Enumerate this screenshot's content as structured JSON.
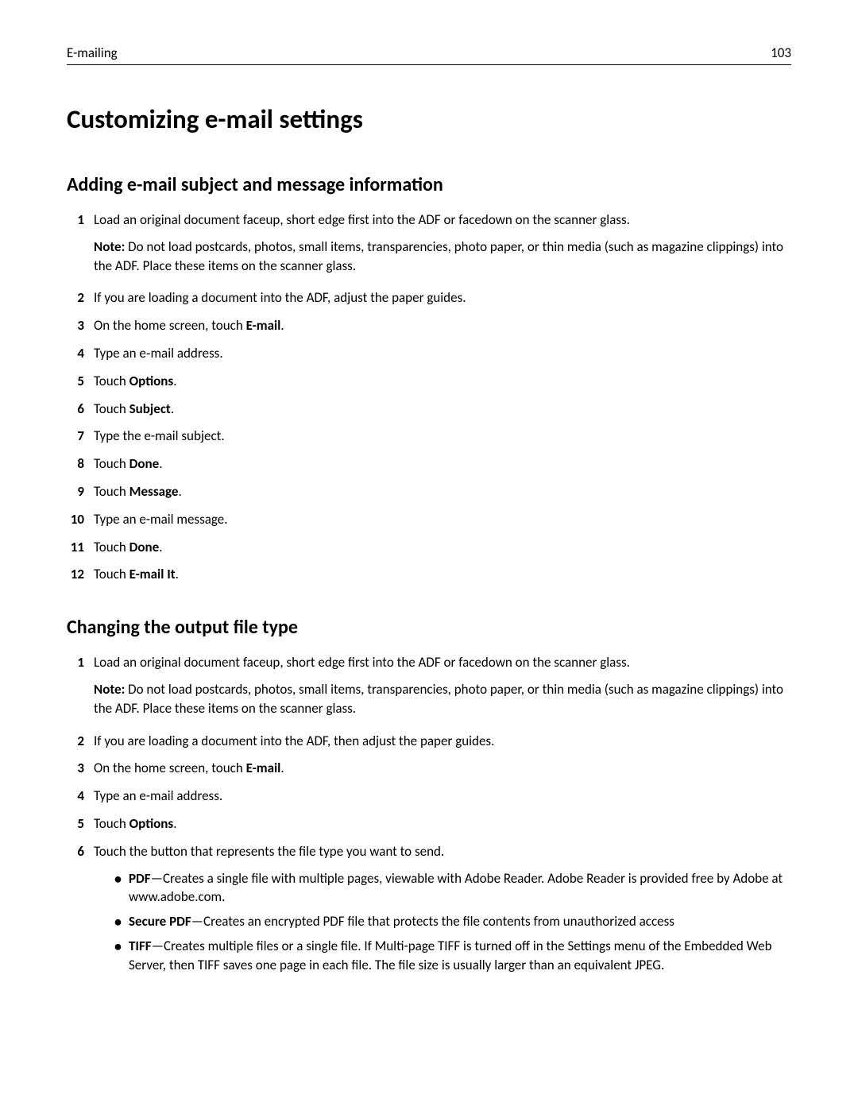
{
  "header": {
    "section_name": "E-mailing",
    "page_number": "103"
  },
  "main_heading": "Customizing e-mail settings",
  "section1": {
    "heading": "Adding e-mail subject and message information",
    "steps": [
      {
        "num": "1",
        "text": "Load an original document faceup, short edge first into the ADF or facedown on the scanner glass.",
        "note_label": "Note:",
        "note_text": " Do not load postcards, photos, small items, transparencies, photo paper, or thin media (such as magazine clippings) into the ADF. Place these items on the scanner glass."
      },
      {
        "num": "2",
        "text": "If you are loading a document into the ADF, adjust the paper guides."
      },
      {
        "num": "3",
        "prefix": "On the home screen, touch ",
        "bold": "E-mail",
        "suffix": "."
      },
      {
        "num": "4",
        "text": "Type an e‑mail address."
      },
      {
        "num": "5",
        "prefix": "Touch ",
        "bold": "Options",
        "suffix": "."
      },
      {
        "num": "6",
        "prefix": "Touch ",
        "bold": "Subject",
        "suffix": "."
      },
      {
        "num": "7",
        "text": "Type the e-mail subject."
      },
      {
        "num": "8",
        "prefix": "Touch ",
        "bold": "Done",
        "suffix": "."
      },
      {
        "num": "9",
        "prefix": "Touch ",
        "bold": "Message",
        "suffix": "."
      },
      {
        "num": "10",
        "text": "Type an e-mail message."
      },
      {
        "num": "11",
        "prefix": "Touch ",
        "bold": "Done",
        "suffix": "."
      },
      {
        "num": "12",
        "prefix": "Touch ",
        "bold": "E-mail It",
        "suffix": "."
      }
    ]
  },
  "section2": {
    "heading": "Changing the output file type",
    "steps": [
      {
        "num": "1",
        "text": "Load an original document faceup, short edge first into the ADF or facedown on the scanner glass.",
        "note_label": "Note:",
        "note_text": " Do not load postcards, photos, small items, transparencies, photo paper, or thin media (such as magazine clippings) into the ADF. Place these items on the scanner glass."
      },
      {
        "num": "2",
        "text": "If you are loading a document into the ADF, then adjust the paper guides."
      },
      {
        "num": "3",
        "prefix": "On the home screen, touch ",
        "bold": "E-mail",
        "suffix": "."
      },
      {
        "num": "4",
        "text": "Type an e-mail address."
      },
      {
        "num": "5",
        "prefix": "Touch ",
        "bold": "Options",
        "suffix": "."
      },
      {
        "num": "6",
        "text": "Touch the button that represents the file type you want to send.",
        "bullets": [
          {
            "bold": "PDF",
            "text": "—Creates a single file with multiple pages, viewable with Adobe Reader. Adobe Reader is provided free by Adobe at www.adobe.com."
          },
          {
            "bold": "Secure PDF",
            "text": "—Creates an encrypted PDF file that protects the file contents from unauthorized access"
          },
          {
            "bold": "TIFF",
            "text": "—Creates multiple files or a single file. If Multi-page TIFF is turned off in the Settings menu of the Embedded Web Server, then TIFF saves one page in each file. The file size is usually larger than an equivalent JPEG."
          }
        ]
      }
    ]
  }
}
